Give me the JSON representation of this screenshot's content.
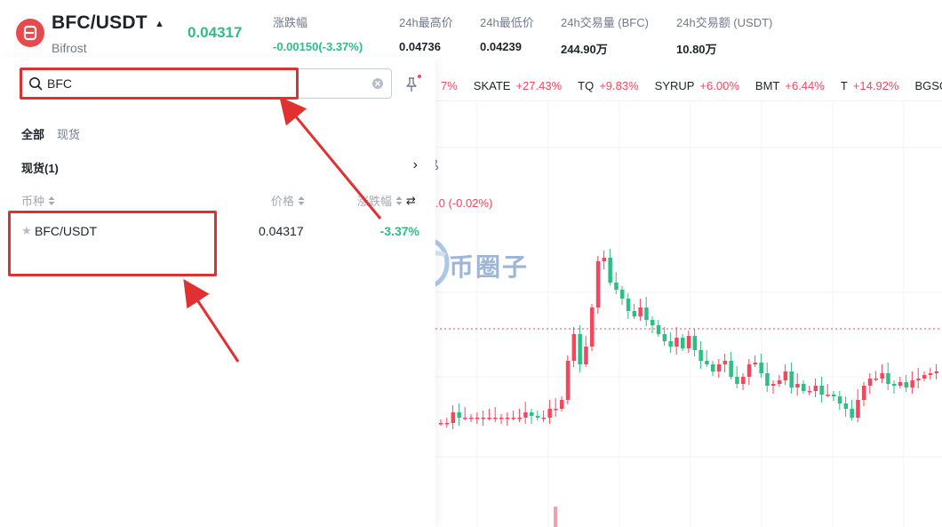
{
  "header": {
    "pair": "BFC/USDT",
    "subtitle": "Bifrost",
    "last_price": "0.04317",
    "stats": [
      {
        "label": "涨跌幅",
        "value": "-0.00150(-3.37%)",
        "tone": "green"
      },
      {
        "label": "24h最高价",
        "value": "0.04736",
        "tone": "normal"
      },
      {
        "label": "24h最低价",
        "value": "0.04239",
        "tone": "normal"
      },
      {
        "label": "24h交易量 (BFC)",
        "value": "244.90万",
        "tone": "normal"
      },
      {
        "label": "24h交易额 (USDT)",
        "value": "10.80万",
        "tone": "normal"
      }
    ]
  },
  "ticker": [
    {
      "symbol": "",
      "change": "7%"
    },
    {
      "symbol": "SKATE",
      "change": "+27.43%"
    },
    {
      "symbol": "TQ",
      "change": "+9.83%"
    },
    {
      "symbol": "SYRUP",
      "change": "+6.00%"
    },
    {
      "symbol": "BMT",
      "change": "+6.44%"
    },
    {
      "symbol": "T",
      "change": "+14.92%"
    },
    {
      "symbol": "BGSC",
      "change": ""
    }
  ],
  "search": {
    "value": "BFC",
    "placeholder": ""
  },
  "tabs": [
    {
      "label": "全部",
      "active": true
    },
    {
      "label": "现货",
      "active": false
    }
  ],
  "section": {
    "label": "现货(1)"
  },
  "columns": {
    "symbol": "币种",
    "price": "价格",
    "change": "涨跌幅"
  },
  "results": [
    {
      "symbol": "BFC/USDT",
      "price": "0.04317",
      "change": "-3.37%"
    }
  ],
  "chart": {
    "delta_text": ".0 (-0.02%)",
    "watermark": "币圈子",
    "glyph": "ß"
  },
  "colors": {
    "up": "#f6465d",
    "down": "#2ebd85",
    "highlight": "#e03030",
    "brand": "#e8494d"
  }
}
